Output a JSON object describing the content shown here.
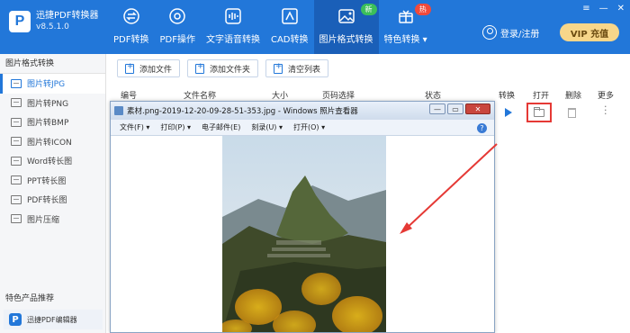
{
  "app": {
    "logo_letter": "P",
    "name": "迅捷PDF转换器",
    "version": "v8.5.1.0"
  },
  "nav": [
    {
      "label": "PDF转换",
      "icon": "convert-icon"
    },
    {
      "label": "PDF操作",
      "icon": "settings-icon"
    },
    {
      "label": "文字语音转换",
      "icon": "audio-wave-icon"
    },
    {
      "label": "CAD转换",
      "icon": "cad-icon"
    },
    {
      "label": "图片格式转换",
      "icon": "image-icon",
      "active": true,
      "badge": "新"
    },
    {
      "label": "特色转换 ▾",
      "icon": "gift-icon",
      "badge": "热"
    }
  ],
  "window_controls": {
    "menu": "≡",
    "minimize": "—",
    "close": "✕"
  },
  "login_label": "登录/注册",
  "vip_label": "VIP 充值",
  "sidebar": {
    "title": "图片格式转换",
    "items": [
      "图片转JPG",
      "图片转PNG",
      "图片转BMP",
      "图片转ICON",
      "Word转长图",
      "PPT转长图",
      "PDF转长图",
      "图片压缩"
    ],
    "active_index": 0,
    "feature_title": "特色产品推荐",
    "product_label": "迅捷PDF编辑器"
  },
  "toolbar": {
    "add_file": "添加文件",
    "add_folder": "添加文件夹",
    "clear_list": "清空列表"
  },
  "table": {
    "headers": {
      "index": "编号",
      "filename": "文件名称",
      "size": "大小",
      "page_select": "页码选择",
      "status": "状态",
      "convert": "转换",
      "open": "打开",
      "delete": "删除",
      "more": "更多"
    }
  },
  "viewer": {
    "title": "素材.png-2019-12-20-09-28-51-353.jpg - Windows 照片查看器",
    "controls": {
      "minimize": "—",
      "maximize": "▭",
      "close": "✕"
    },
    "menu": [
      "文件(F) ▾",
      "打印(P) ▾",
      "电子邮件(E)",
      "刻录(U) ▾",
      "打开(O) ▾"
    ],
    "help": "?"
  },
  "colors": {
    "brand": "#2277d9",
    "active_nav": "#1a5fb8",
    "highlight": "#e53935"
  }
}
